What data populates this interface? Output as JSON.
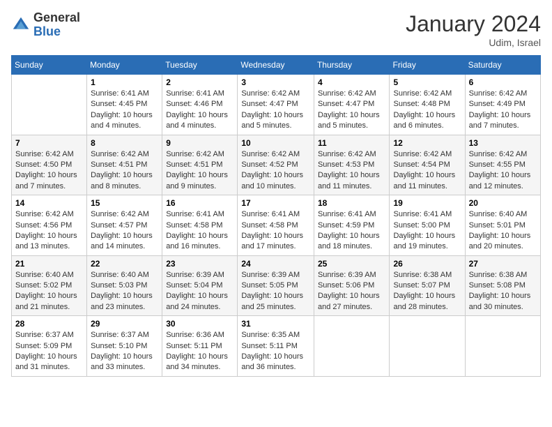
{
  "logo": {
    "general": "General",
    "blue": "Blue"
  },
  "title": "January 2024",
  "location": "Udim, Israel",
  "days_of_week": [
    "Sunday",
    "Monday",
    "Tuesday",
    "Wednesday",
    "Thursday",
    "Friday",
    "Saturday"
  ],
  "weeks": [
    [
      {
        "day": "",
        "info": ""
      },
      {
        "day": "1",
        "info": "Sunrise: 6:41 AM\nSunset: 4:45 PM\nDaylight: 10 hours and 4 minutes."
      },
      {
        "day": "2",
        "info": "Sunrise: 6:41 AM\nSunset: 4:46 PM\nDaylight: 10 hours and 4 minutes."
      },
      {
        "day": "3",
        "info": "Sunrise: 6:42 AM\nSunset: 4:47 PM\nDaylight: 10 hours and 5 minutes."
      },
      {
        "day": "4",
        "info": "Sunrise: 6:42 AM\nSunset: 4:47 PM\nDaylight: 10 hours and 5 minutes."
      },
      {
        "day": "5",
        "info": "Sunrise: 6:42 AM\nSunset: 4:48 PM\nDaylight: 10 hours and 6 minutes."
      },
      {
        "day": "6",
        "info": "Sunrise: 6:42 AM\nSunset: 4:49 PM\nDaylight: 10 hours and 7 minutes."
      }
    ],
    [
      {
        "day": "7",
        "info": "Sunrise: 6:42 AM\nSunset: 4:50 PM\nDaylight: 10 hours and 7 minutes."
      },
      {
        "day": "8",
        "info": "Sunrise: 6:42 AM\nSunset: 4:51 PM\nDaylight: 10 hours and 8 minutes."
      },
      {
        "day": "9",
        "info": "Sunrise: 6:42 AM\nSunset: 4:51 PM\nDaylight: 10 hours and 9 minutes."
      },
      {
        "day": "10",
        "info": "Sunrise: 6:42 AM\nSunset: 4:52 PM\nDaylight: 10 hours and 10 minutes."
      },
      {
        "day": "11",
        "info": "Sunrise: 6:42 AM\nSunset: 4:53 PM\nDaylight: 10 hours and 11 minutes."
      },
      {
        "day": "12",
        "info": "Sunrise: 6:42 AM\nSunset: 4:54 PM\nDaylight: 10 hours and 11 minutes."
      },
      {
        "day": "13",
        "info": "Sunrise: 6:42 AM\nSunset: 4:55 PM\nDaylight: 10 hours and 12 minutes."
      }
    ],
    [
      {
        "day": "14",
        "info": "Sunrise: 6:42 AM\nSunset: 4:56 PM\nDaylight: 10 hours and 13 minutes."
      },
      {
        "day": "15",
        "info": "Sunrise: 6:42 AM\nSunset: 4:57 PM\nDaylight: 10 hours and 14 minutes."
      },
      {
        "day": "16",
        "info": "Sunrise: 6:41 AM\nSunset: 4:58 PM\nDaylight: 10 hours and 16 minutes."
      },
      {
        "day": "17",
        "info": "Sunrise: 6:41 AM\nSunset: 4:58 PM\nDaylight: 10 hours and 17 minutes."
      },
      {
        "day": "18",
        "info": "Sunrise: 6:41 AM\nSunset: 4:59 PM\nDaylight: 10 hours and 18 minutes."
      },
      {
        "day": "19",
        "info": "Sunrise: 6:41 AM\nSunset: 5:00 PM\nDaylight: 10 hours and 19 minutes."
      },
      {
        "day": "20",
        "info": "Sunrise: 6:40 AM\nSunset: 5:01 PM\nDaylight: 10 hours and 20 minutes."
      }
    ],
    [
      {
        "day": "21",
        "info": "Sunrise: 6:40 AM\nSunset: 5:02 PM\nDaylight: 10 hours and 21 minutes."
      },
      {
        "day": "22",
        "info": "Sunrise: 6:40 AM\nSunset: 5:03 PM\nDaylight: 10 hours and 23 minutes."
      },
      {
        "day": "23",
        "info": "Sunrise: 6:39 AM\nSunset: 5:04 PM\nDaylight: 10 hours and 24 minutes."
      },
      {
        "day": "24",
        "info": "Sunrise: 6:39 AM\nSunset: 5:05 PM\nDaylight: 10 hours and 25 minutes."
      },
      {
        "day": "25",
        "info": "Sunrise: 6:39 AM\nSunset: 5:06 PM\nDaylight: 10 hours and 27 minutes."
      },
      {
        "day": "26",
        "info": "Sunrise: 6:38 AM\nSunset: 5:07 PM\nDaylight: 10 hours and 28 minutes."
      },
      {
        "day": "27",
        "info": "Sunrise: 6:38 AM\nSunset: 5:08 PM\nDaylight: 10 hours and 30 minutes."
      }
    ],
    [
      {
        "day": "28",
        "info": "Sunrise: 6:37 AM\nSunset: 5:09 PM\nDaylight: 10 hours and 31 minutes."
      },
      {
        "day": "29",
        "info": "Sunrise: 6:37 AM\nSunset: 5:10 PM\nDaylight: 10 hours and 33 minutes."
      },
      {
        "day": "30",
        "info": "Sunrise: 6:36 AM\nSunset: 5:11 PM\nDaylight: 10 hours and 34 minutes."
      },
      {
        "day": "31",
        "info": "Sunrise: 6:35 AM\nSunset: 5:11 PM\nDaylight: 10 hours and 36 minutes."
      },
      {
        "day": "",
        "info": ""
      },
      {
        "day": "",
        "info": ""
      },
      {
        "day": "",
        "info": ""
      }
    ]
  ]
}
